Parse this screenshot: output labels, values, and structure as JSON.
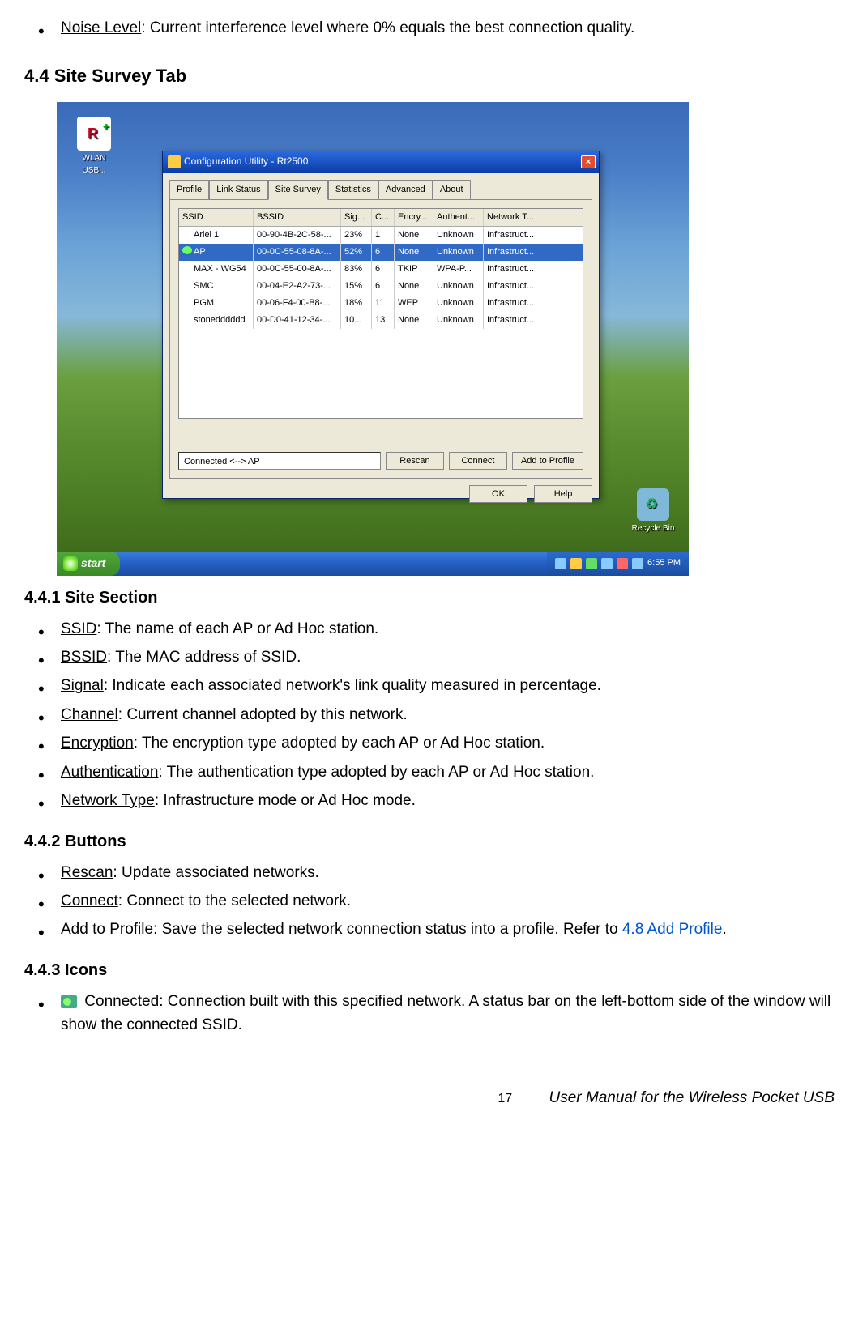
{
  "intro": {
    "noise_label": "Noise Level",
    "noise_text": ": Current interference level where 0% equals the best connection quality."
  },
  "heading_44": "4.4 Site Survey Tab",
  "screenshot": {
    "desk_icon_label": "WLAN USB...",
    "recycle_label": "Recycle Bin",
    "start_label": "start",
    "clock": "6:55 PM",
    "dialog": {
      "title": "Configuration Utility - Rt2500",
      "tabs": [
        "Profile",
        "Link Status",
        "Site Survey",
        "Statistics",
        "Advanced",
        "About"
      ],
      "active_tab_index": 2,
      "columns": [
        "SSID",
        "BSSID",
        "Sig...",
        "C...",
        "Encry...",
        "Authent...",
        "Network T..."
      ],
      "rows": [
        {
          "ssid": "Ariel 1",
          "bssid": "00-90-4B-2C-58-...",
          "sig": "23%",
          "ch": "1",
          "enc": "None",
          "auth": "Unknown",
          "nt": "Infrastruct..."
        },
        {
          "ssid": "AP",
          "bssid": "00-0C-55-08-8A-...",
          "sig": "52%",
          "ch": "6",
          "enc": "None",
          "auth": "Unknown",
          "nt": "Infrastruct...",
          "selected": true
        },
        {
          "ssid": "MAX - WG54",
          "bssid": "00-0C-55-00-8A-...",
          "sig": "83%",
          "ch": "6",
          "enc": "TKIP",
          "auth": "WPA-P...",
          "nt": "Infrastruct..."
        },
        {
          "ssid": "SMC",
          "bssid": "00-04-E2-A2-73-...",
          "sig": "15%",
          "ch": "6",
          "enc": "None",
          "auth": "Unknown",
          "nt": "Infrastruct..."
        },
        {
          "ssid": "PGM",
          "bssid": "00-06-F4-00-B8-...",
          "sig": "18%",
          "ch": "11",
          "enc": "WEP",
          "auth": "Unknown",
          "nt": "Infrastruct..."
        },
        {
          "ssid": "stonedddddd",
          "bssid": "00-D0-41-12-34-...",
          "sig": "10...",
          "ch": "13",
          "enc": "None",
          "auth": "Unknown",
          "nt": "Infrastruct..."
        }
      ],
      "status_text": "Connected <--> AP",
      "buttons": {
        "rescan": "Rescan",
        "connect": "Connect",
        "add": "Add to Profile",
        "ok": "OK",
        "help": "Help"
      }
    }
  },
  "s441": {
    "heading": "4.4.1 Site Section",
    "items": [
      {
        "label": "SSID",
        "text": ": The name of each AP or Ad Hoc station."
      },
      {
        "label": "BSSID",
        "text": ": The MAC address of SSID."
      },
      {
        "label": "Signal",
        "text": ": Indicate each associated network's link quality measured in percentage."
      },
      {
        "label": "Channel",
        "text": ": Current channel adopted by this network."
      },
      {
        "label": "Encryption",
        "text": ": The encryption type adopted by each AP or Ad Hoc station."
      },
      {
        "label": "Authentication",
        "text": ": The authentication type adopted by each AP or Ad Hoc station."
      },
      {
        "label": "Network Type",
        "text": ": Infrastructure mode or Ad Hoc mode."
      }
    ]
  },
  "s442": {
    "heading": "4.4.2 Buttons",
    "items": [
      {
        "label": "Rescan",
        "text": ": Update associated networks."
      },
      {
        "label": "Connect",
        "text": ": Connect to the selected network."
      },
      {
        "label": "Add to Profile",
        "text": ": Save the selected network connection status into a profile. Refer to ",
        "link": "4.8 Add Profile",
        "after": "."
      }
    ]
  },
  "s443": {
    "heading": "4.4.3 Icons",
    "item": {
      "label": "Connected",
      "text": ": Connection built with this specified network. A status bar on the left-bottom side of the window will show the connected SSID."
    }
  },
  "footer": {
    "page": "17",
    "title": "User Manual for the Wireless Pocket USB"
  }
}
